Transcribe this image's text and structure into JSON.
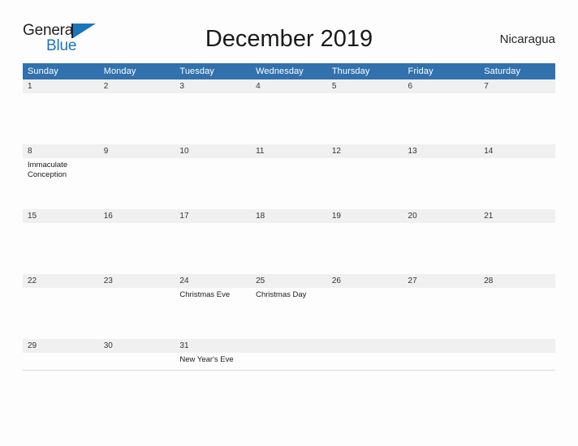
{
  "brand": {
    "logo_line1": "General",
    "logo_line2": "Blue",
    "logo_icon": "flag-triangle-icon",
    "color_primary": "#1b75bb",
    "color_dark": "#231f20"
  },
  "header": {
    "title": "December 2019",
    "country": "Nicaragua"
  },
  "theme": {
    "header_blue": "#3171ad",
    "daynum_band": "#f0f0f0",
    "page_background": "#fdfdfd",
    "text": "#222222"
  },
  "calendar": {
    "month": "December",
    "year": "2019",
    "weekday_headers": [
      "Sunday",
      "Monday",
      "Tuesday",
      "Wednesday",
      "Thursday",
      "Friday",
      "Saturday"
    ],
    "weeks": [
      {
        "days": [
          {
            "number": "1",
            "event": ""
          },
          {
            "number": "2",
            "event": ""
          },
          {
            "number": "3",
            "event": ""
          },
          {
            "number": "4",
            "event": ""
          },
          {
            "number": "5",
            "event": ""
          },
          {
            "number": "6",
            "event": ""
          },
          {
            "number": "7",
            "event": ""
          }
        ]
      },
      {
        "days": [
          {
            "number": "8",
            "event": "Immaculate Conception"
          },
          {
            "number": "9",
            "event": ""
          },
          {
            "number": "10",
            "event": ""
          },
          {
            "number": "11",
            "event": ""
          },
          {
            "number": "12",
            "event": ""
          },
          {
            "number": "13",
            "event": ""
          },
          {
            "number": "14",
            "event": ""
          }
        ]
      },
      {
        "days": [
          {
            "number": "15",
            "event": ""
          },
          {
            "number": "16",
            "event": ""
          },
          {
            "number": "17",
            "event": ""
          },
          {
            "number": "18",
            "event": ""
          },
          {
            "number": "19",
            "event": ""
          },
          {
            "number": "20",
            "event": ""
          },
          {
            "number": "21",
            "event": ""
          }
        ]
      },
      {
        "days": [
          {
            "number": "22",
            "event": ""
          },
          {
            "number": "23",
            "event": ""
          },
          {
            "number": "24",
            "event": "Christmas Eve"
          },
          {
            "number": "25",
            "event": "Christmas Day"
          },
          {
            "number": "26",
            "event": ""
          },
          {
            "number": "27",
            "event": ""
          },
          {
            "number": "28",
            "event": ""
          }
        ]
      },
      {
        "days": [
          {
            "number": "29",
            "event": ""
          },
          {
            "number": "30",
            "event": ""
          },
          {
            "number": "31",
            "event": "New Year's Eve"
          },
          {
            "number": "",
            "event": ""
          },
          {
            "number": "",
            "event": ""
          },
          {
            "number": "",
            "event": ""
          },
          {
            "number": "",
            "event": ""
          }
        ]
      }
    ]
  }
}
